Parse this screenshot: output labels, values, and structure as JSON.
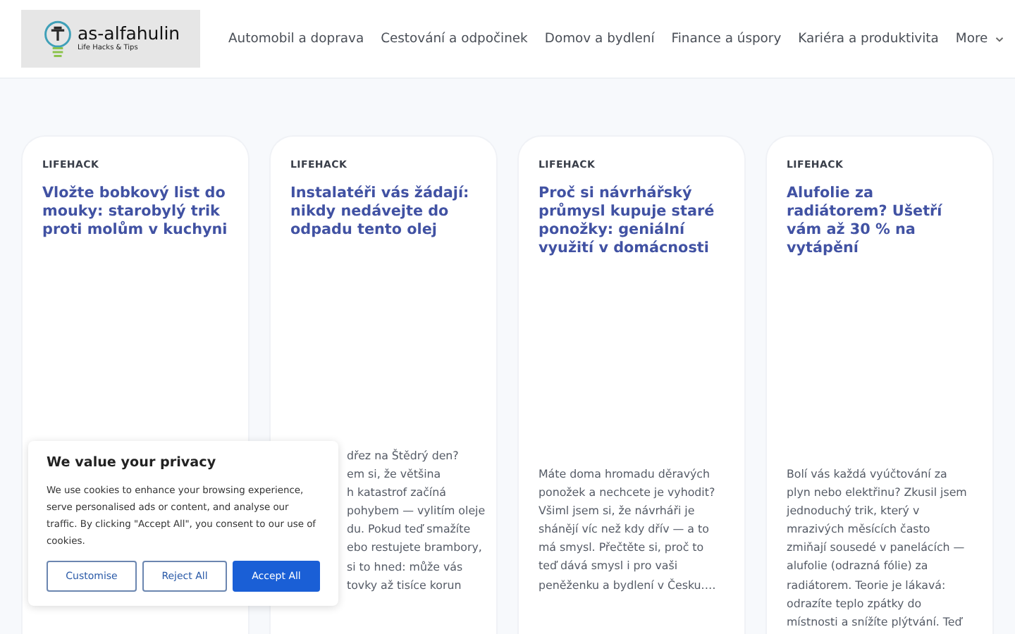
{
  "header": {
    "logo": {
      "name": "as-alfahulin",
      "tagline": "Life Hacks & Tips"
    },
    "nav": [
      {
        "label": "Automobil a doprava"
      },
      {
        "label": "Cestování a odpočinek"
      },
      {
        "label": "Domov a bydlení"
      },
      {
        "label": "Finance a úspory"
      },
      {
        "label": "Kariéra a produktivita"
      },
      {
        "label": "More",
        "dropdown": true
      }
    ]
  },
  "cards": [
    {
      "category": "LIFEHACK",
      "title": "Vložte bobkový list do mouky: starobylý trik proti molům v kuchyni"
    },
    {
      "category": "LIFEHACK",
      "title": "Instalatéři vás žádají: nikdy nedávejte do odpadu tento olej",
      "excerpt_lines": [
        "dřez na Štědrý den?",
        "em si, že většina",
        "h katastrof začíná",
        "pohybem — vylitím oleje",
        "du. Pokud teď smažíte",
        "ebo restujete brambory,",
        "si to hned: může vás",
        "tovky až tisíce korun"
      ]
    },
    {
      "category": "LIFEHACK",
      "title": "Proč si návrhářský průmysl kupuje staré ponožky: geniální využití v domácnosti",
      "excerpt": "Máte doma hromadu děravých ponožek a nechcete je vyhodit? Všiml jsem si, že návrháři je shánějí víc než kdy dřív — a to má smysl. Přečtěte si, proč to teď dává smysl i pro vaši peněženku a bydlení v Česku.…"
    },
    {
      "category": "LIFEHACK",
      "title": "Alufolie za radiátorem? Ušetří vám až 30 % na vytápění",
      "excerpt": "Bolí vás každá vyúčtování za plyn nebo elektřinu? Zkusil jsem jednoduchý trik, který v mrazivých měsících často zmiňají sousedé v panelácích — alufolie (odrazná fólie) za radiátorem. Teorie je lákavá: odrazíte teplo zpátky do místnosti a snížíte plýtvání. Teď"
    }
  ],
  "cookie_banner": {
    "title": "We value your privacy",
    "text": "We use cookies to enhance your browsing experience, serve personalised ads or content, and analyse our traffic. By clicking \"Accept All\", you consent to our use of cookies.",
    "buttons": [
      {
        "label": "Customise",
        "kind": "outline"
      },
      {
        "label": "Reject All",
        "kind": "outline"
      },
      {
        "label": "Accept All",
        "kind": "primary"
      }
    ]
  }
}
